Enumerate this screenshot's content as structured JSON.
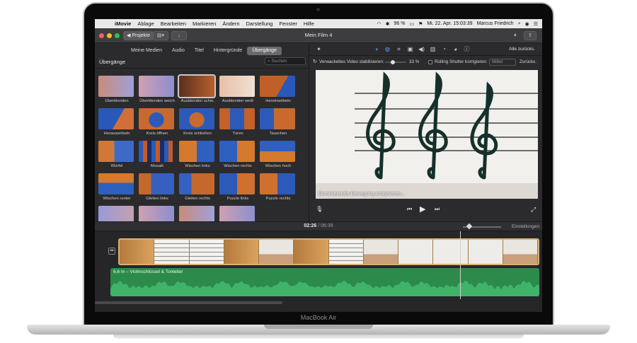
{
  "laptop": {
    "brand": "MacBook Air"
  },
  "menubar": {
    "apple": "",
    "app_name": "iMovie",
    "items": [
      "Ablage",
      "Bearbeiten",
      "Markieren",
      "Ändern",
      "Darstellung",
      "Fenster",
      "Hilfe"
    ],
    "battery": "96 %",
    "datetime": "Mi. 22. Apr. 15:03:39",
    "user": "Marcus Friedrich"
  },
  "toolbar": {
    "projects_label": "◀ Projekte",
    "title": "Mein Film 4"
  },
  "browser": {
    "tabs": [
      "Meine Medien",
      "Audio",
      "Titel",
      "Hintergründe",
      "Übergänge"
    ],
    "active_tab": "Übergänge",
    "section_title": "Übergänge",
    "search_placeholder": "Suchen",
    "transitions": [
      {
        "label": "Überblenden",
        "style": "t-fade"
      },
      {
        "label": "Überblenden weich",
        "style": "t-soft"
      },
      {
        "label": "Ausblenden schw.",
        "style": "t-black",
        "selected": true
      },
      {
        "label": "Ausblenden weiß",
        "style": "t-white"
      },
      {
        "label": "Hereinwirbeln",
        "style": "t-in"
      },
      {
        "label": "Herauswirbeln",
        "style": "t-out"
      },
      {
        "label": "Kreis öffnen",
        "style": "t-circ"
      },
      {
        "label": "Kreis schließen",
        "style": "t-circc"
      },
      {
        "label": "Türen",
        "style": "t-door"
      },
      {
        "label": "Tauschen",
        "style": "t-swap"
      },
      {
        "label": "Würfel",
        "style": "t-cube"
      },
      {
        "label": "Mosaik",
        "style": "t-mosaic"
      },
      {
        "label": "Wischen links",
        "style": "t-wl"
      },
      {
        "label": "Wischen rechts",
        "style": "t-wr"
      },
      {
        "label": "Wischen hoch",
        "style": "t-wu"
      },
      {
        "label": "Wischen runter",
        "style": "t-wd"
      },
      {
        "label": "Gleiten links",
        "style": "t-gl"
      },
      {
        "label": "Gleiten rechts",
        "style": "t-gr"
      },
      {
        "label": "Puzzle links",
        "style": "t-pl"
      },
      {
        "label": "Puzzle rechts",
        "style": "t-pr"
      },
      {
        "label": "",
        "style": "t-last"
      },
      {
        "label": "",
        "style": "t-soft"
      },
      {
        "label": "",
        "style": "t-fade"
      },
      {
        "label": "",
        "style": "t-soft"
      }
    ]
  },
  "viewer": {
    "reset_all": "Alle zurücks.",
    "stabilize_label": "Verwackeltes Video stabilisieren:",
    "stabilize_value": "33 %",
    "stabilize_level": 0.33,
    "rolling_label": "Rolling Shutter korrigieren:",
    "rolling_value": "Mittel",
    "reset": "Zurücks.",
    "analyze_text": "Dominierende Bewegung analysieren..."
  },
  "timeline": {
    "current": "02:26",
    "separator": "/",
    "duration": "06:39",
    "settings": "Einstellungen",
    "audio_label": "6,6 m – Violinschlüssel & Tonleiter"
  },
  "colors": {
    "close": "#ff5f57",
    "minimize": "#febc2e",
    "zoom": "#28c840",
    "accent": "#5aa0ff",
    "audio": "#2c8a4a"
  }
}
